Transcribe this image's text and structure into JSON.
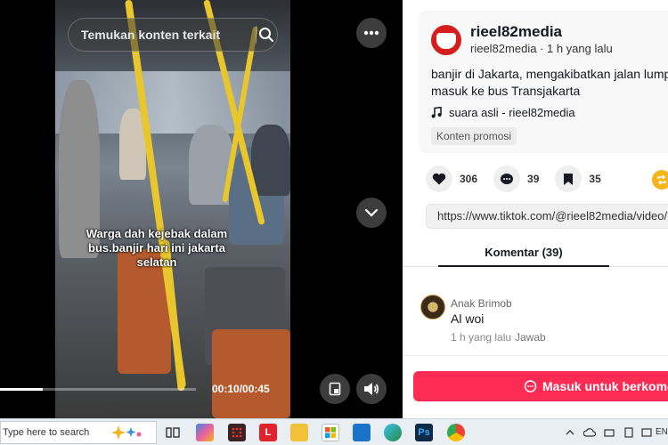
{
  "video": {
    "search_placeholder": "Temukan konten terkait",
    "subtitle": "Warga dah kejebak dalam bus.banjir hari ini jakarta selatan",
    "time": "00:10/00:45",
    "progress": 0.22
  },
  "post": {
    "username": "rieel82media",
    "meta": "rieel82media · 1 h yang lalu",
    "description_line1": "banjir di Jakarta, mengakibatkan jalan lump",
    "description_line2": "masuk ke bus Transjakarta",
    "music": "suara asli - rieel82media",
    "promo": "Konten promosi",
    "likes": "306",
    "comments": "39",
    "saves": "35",
    "url": "https://www.tiktok.com/@rieel82media/video/7"
  },
  "tabs": {
    "comments": "Komentar (39)"
  },
  "comment": {
    "author": "Anak Brimob",
    "text": "Al woi",
    "time": "1 h yang lalu",
    "reply": "Jawab"
  },
  "login": {
    "label": "Masuk untuk berkome"
  },
  "taskbar": {
    "search_placeholder": "Type here to search",
    "lang": "EN"
  },
  "colors": {
    "accent": "#fe2c55",
    "pole": "#e8c62c",
    "share": "#f5b51b"
  }
}
